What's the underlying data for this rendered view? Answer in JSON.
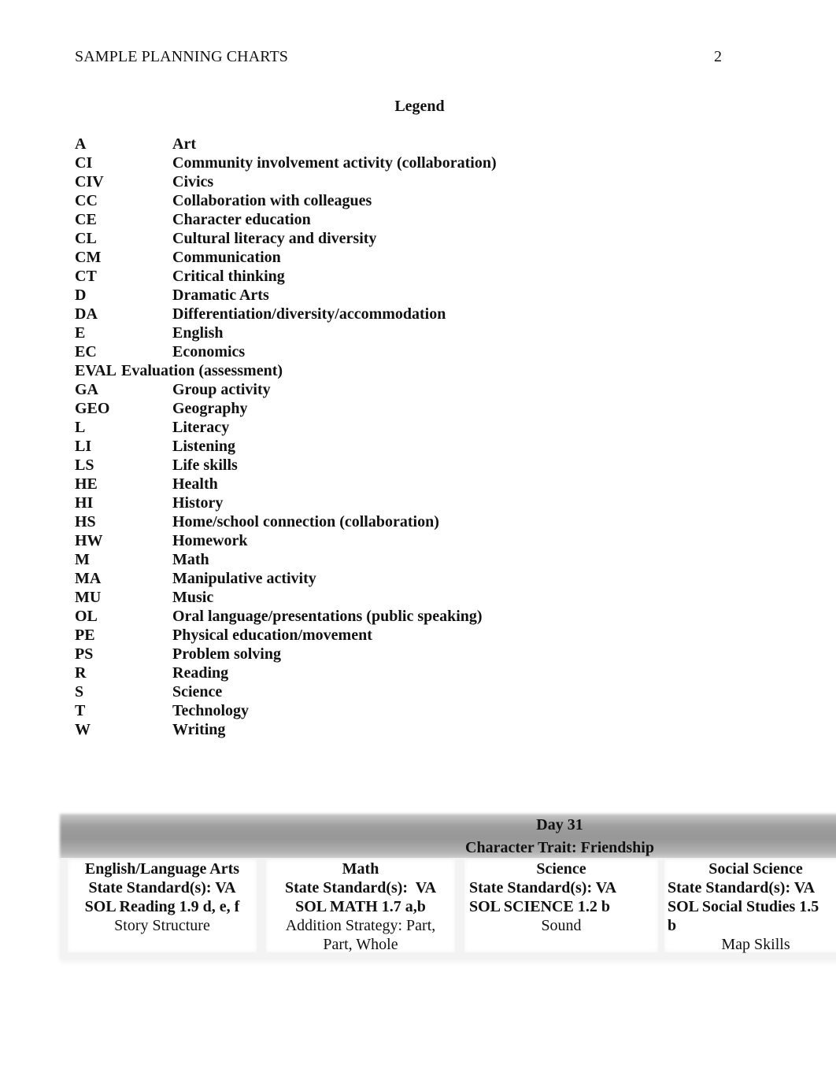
{
  "header": {
    "running_head": "SAMPLE PLANNING CHARTS",
    "page_number": "2"
  },
  "legend": {
    "title": "Legend",
    "items": [
      {
        "code": "A",
        "meaning": "Art"
      },
      {
        "code": "CI",
        "meaning": "Community involvement activity (collaboration)"
      },
      {
        "code": "CIV",
        "meaning": "Civics"
      },
      {
        "code": "CC",
        "meaning": "Collaboration with colleagues"
      },
      {
        "code": "CE",
        "meaning": "Character education"
      },
      {
        "code": "CL",
        "meaning": "Cultural literacy and diversity"
      },
      {
        "code": "CM",
        "meaning": "Communication"
      },
      {
        "code": "CT",
        "meaning": "Critical thinking"
      },
      {
        "code": "D",
        "meaning": "Dramatic Arts"
      },
      {
        "code": "DA",
        "meaning": "Differentiation/diversity/accommodation"
      },
      {
        "code": "E",
        "meaning": "English"
      },
      {
        "code": "EC",
        "meaning": "Economics"
      },
      {
        "code": "EVAL",
        "meaning": "Evaluation (assessment)"
      },
      {
        "code": "GA",
        "meaning": "Group activity"
      },
      {
        "code": "GEO",
        "meaning": "Geography"
      },
      {
        "code": "L",
        "meaning": "Literacy"
      },
      {
        "code": "LI",
        "meaning": "Listening"
      },
      {
        "code": "LS",
        "meaning": "Life skills"
      },
      {
        "code": "HE",
        "meaning": "Health"
      },
      {
        "code": "HI",
        "meaning": "History"
      },
      {
        "code": "HS",
        "meaning": "Home/school connection (collaboration)"
      },
      {
        "code": "HW",
        "meaning": "Homework"
      },
      {
        "code": "M",
        "meaning": "Math"
      },
      {
        "code": "MA",
        "meaning": "Manipulative activity"
      },
      {
        "code": "MU",
        "meaning": "Music"
      },
      {
        "code": "OL",
        "meaning": "Oral language/presentations (public speaking)"
      },
      {
        "code": "PE",
        "meaning": "Physical education/movement"
      },
      {
        "code": "PS",
        "meaning": "Problem solving"
      },
      {
        "code": "R",
        "meaning": "Reading"
      },
      {
        "code": "S",
        "meaning": "Science"
      },
      {
        "code": "T",
        "meaning": "Technology"
      },
      {
        "code": "W",
        "meaning": "Writing"
      }
    ]
  },
  "planning_chart": {
    "day": "Day 31",
    "character_trait": "Character Trait: Friendship",
    "columns": [
      {
        "subject": "English/Language Arts",
        "standard_line1": "State Standard(s): VA",
        "standard_line2": "SOL Reading 1.9 d, e, f",
        "topic": "Story Structure"
      },
      {
        "subject": "Math",
        "standard_line1": "State Standard(s):  VA",
        "standard_line2": "SOL MATH 1.7 a,b",
        "topic_line1": "Addition Strategy: Part,",
        "topic_line2": "Part, Whole"
      },
      {
        "subject": "Science",
        "standard_line1": "State Standard(s): VA",
        "standard_line2": "SOL SCIENCE 1.2 b",
        "topic": "Sound"
      },
      {
        "subject": "Social Science",
        "standard_line1": "State Standard(s): VA",
        "standard_line2": "SOL Social Studies 1.5",
        "standard_line3": "b",
        "topic": "Map Skills"
      }
    ]
  }
}
